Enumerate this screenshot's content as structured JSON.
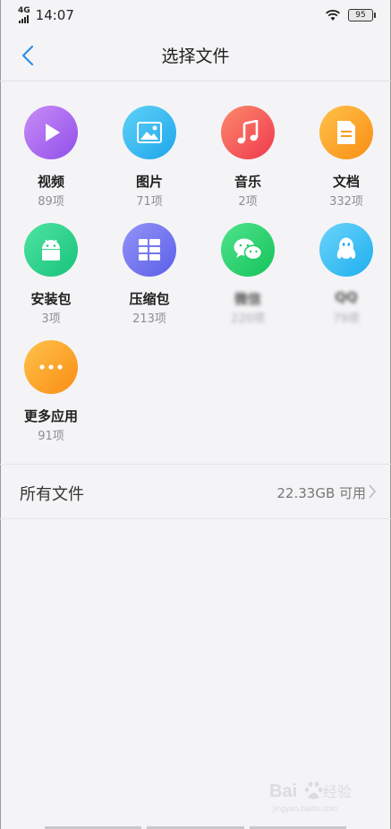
{
  "status": {
    "network": "4G",
    "time": "14:07",
    "battery": "95"
  },
  "header": {
    "title": "选择文件"
  },
  "categories": [
    {
      "label": "视频",
      "count": "89项",
      "icon": "play-icon",
      "color": "#a264f0"
    },
    {
      "label": "图片",
      "count": "71项",
      "icon": "image-icon",
      "color": "#2fb7ef"
    },
    {
      "label": "音乐",
      "count": "2项",
      "icon": "music-note-icon",
      "color": "#f4555a"
    },
    {
      "label": "文档",
      "count": "332项",
      "icon": "document-icon",
      "color": "#fca42a"
    },
    {
      "label": "安装包",
      "count": "3项",
      "icon": "android-icon",
      "color": "#2ed58c"
    },
    {
      "label": "压缩包",
      "count": "213项",
      "icon": "archive-icon",
      "color": "#6e72f0"
    },
    {
      "label": "微信",
      "count": "220项",
      "icon": "wechat-icon",
      "color": "#2dd46b"
    },
    {
      "label": "QQ",
      "count": "79项",
      "icon": "qq-penguin-icon",
      "color": "#2ebcf4"
    },
    {
      "label": "更多应用",
      "count": "91项",
      "icon": "more-dots-icon",
      "color": "#fca42a"
    }
  ],
  "all_files": {
    "label": "所有文件",
    "storage": "22.33GB 可用"
  }
}
